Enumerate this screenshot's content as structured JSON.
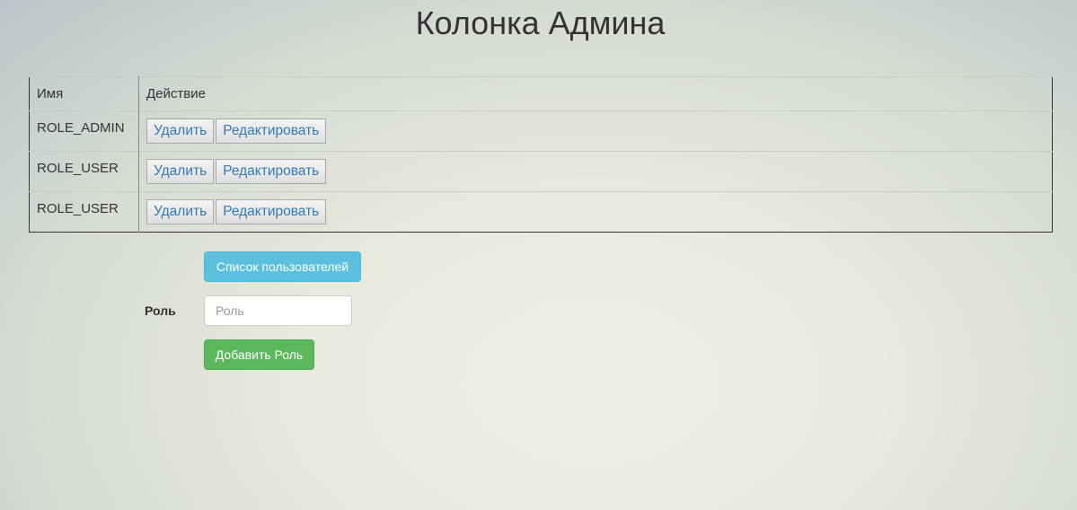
{
  "header": {
    "title": "Колонка Админа"
  },
  "table": {
    "columns": [
      "Имя",
      "Действие"
    ],
    "rows": [
      {
        "name": "ROLE_ADMIN",
        "delete_label": "Удалить",
        "edit_label": "Редактировать"
      },
      {
        "name": "ROLE_USER",
        "delete_label": "Удалить",
        "edit_label": "Редактировать"
      },
      {
        "name": "ROLE_USER",
        "delete_label": "Удалить",
        "edit_label": "Редактировать"
      }
    ]
  },
  "form": {
    "user_list_button": "Список пользователей",
    "role_label": "Роль",
    "role_input_value": "",
    "role_input_placeholder": "Роль",
    "add_role_button": "Добавить Роль"
  },
  "colors": {
    "info": "#5bc0de",
    "success": "#5cb85c",
    "link": "#337ab7"
  }
}
